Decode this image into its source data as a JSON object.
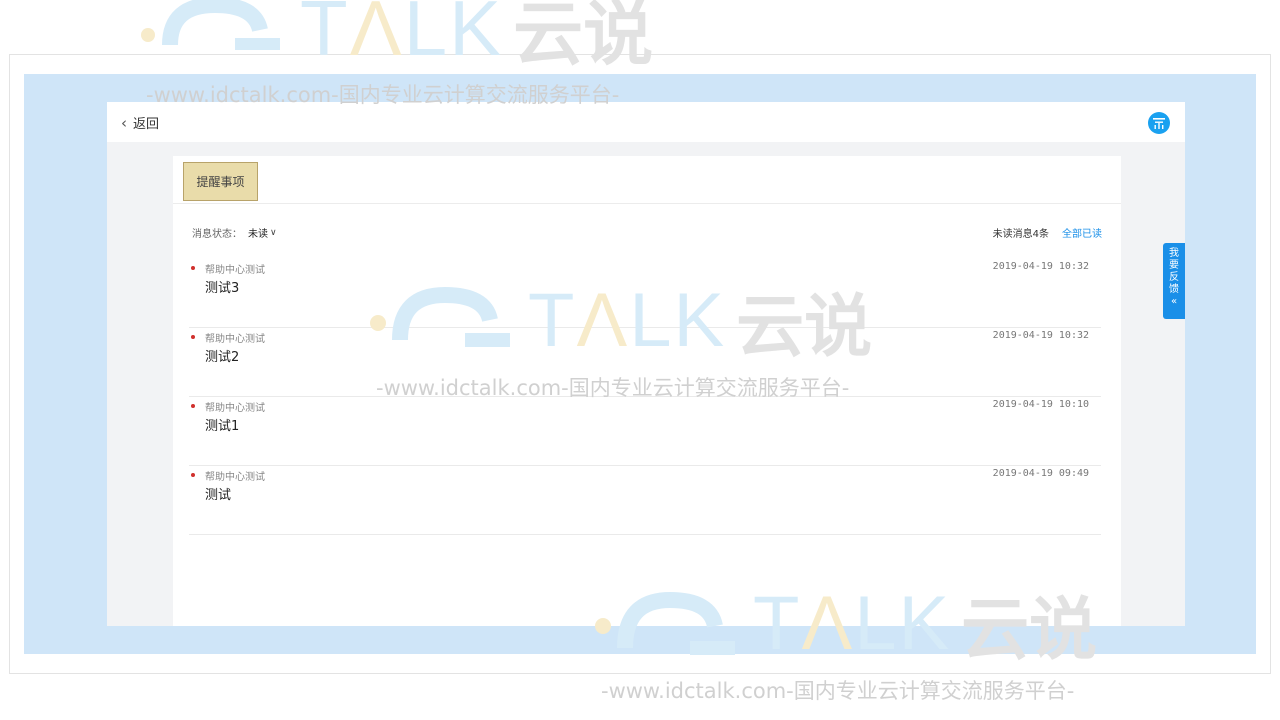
{
  "topbar": {
    "back_label": "返回"
  },
  "tab": {
    "label": "提醒事项"
  },
  "filter": {
    "label": "消息状态：",
    "value": "未读"
  },
  "summary": {
    "unread": "未读消息4条",
    "mark_all": "全部已读"
  },
  "messages": [
    {
      "category": "帮助中心测试",
      "title": "测试3",
      "time": "2019-04-19 10:32"
    },
    {
      "category": "帮助中心测试",
      "title": "测试2",
      "time": "2019-04-19 10:32"
    },
    {
      "category": "帮助中心测试",
      "title": "测试1",
      "time": "2019-04-19 10:10"
    },
    {
      "category": "帮助中心测试",
      "title": "测试",
      "time": "2019-04-19 09:49"
    }
  ],
  "feedback": {
    "chars": [
      "我",
      "要",
      "反",
      "馈",
      "«"
    ]
  },
  "watermark": {
    "brand_t": "T",
    "brand_a": "Λ",
    "brand_lk": "LK",
    "cn": "云说",
    "slogan": "-www.idctalk.com-国内专业云计算交流服务平台-"
  },
  "colors": {
    "accent": "#1a8fe8",
    "unread_dot": "#d0312d",
    "tab_bg": "#e9dcaa",
    "outer_bg": "#cfe5f8"
  },
  "icons": {
    "back": "chevron-left-icon",
    "help": "help-badge-icon",
    "feedback": "double-chevron-left-icon"
  }
}
